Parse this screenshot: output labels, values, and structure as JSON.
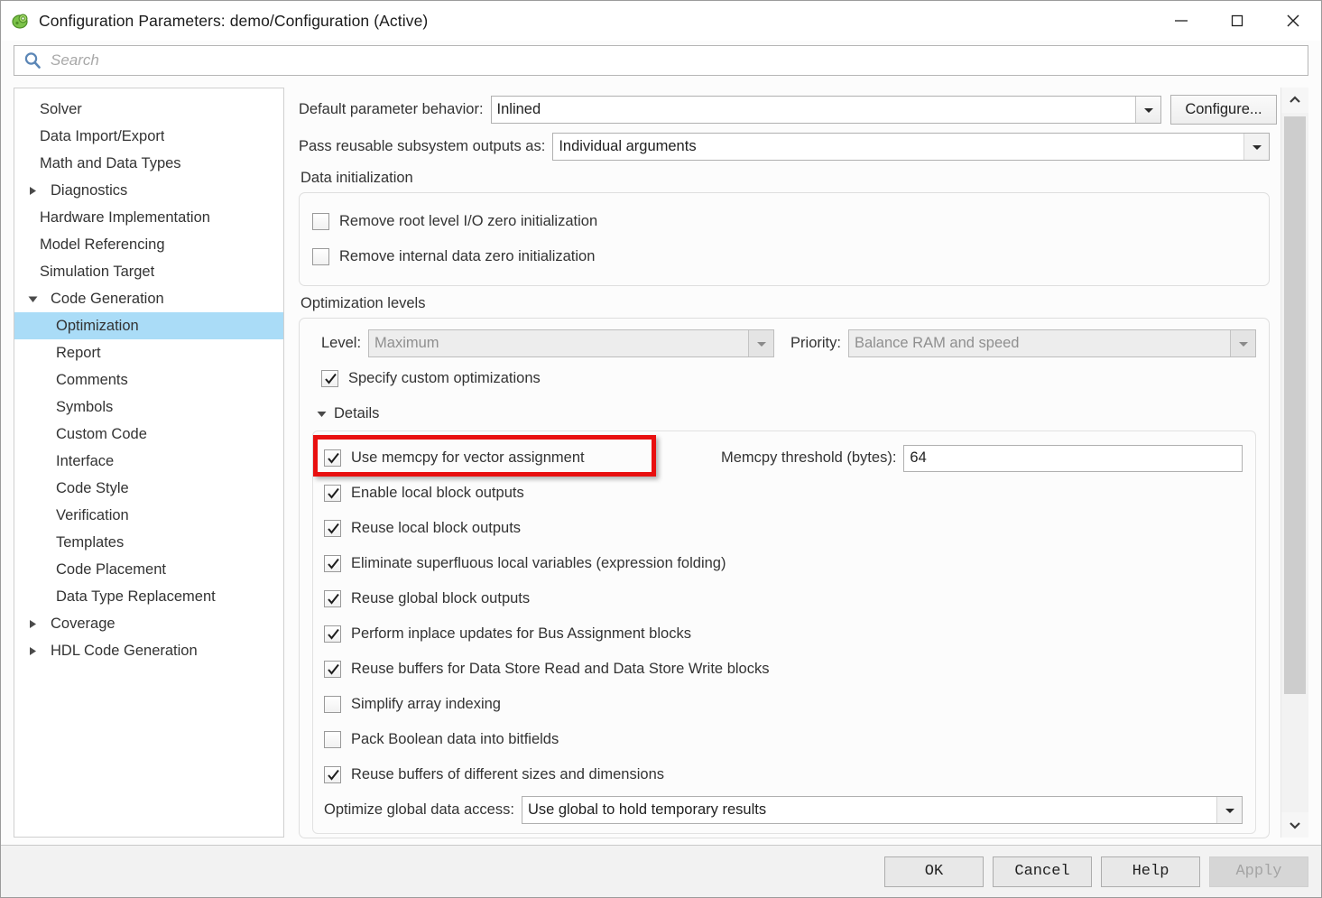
{
  "window": {
    "title": "Configuration Parameters: demo/Configuration (Active)",
    "app_icon": "simulink-logo-icon",
    "minimize_label": "—",
    "maximize_label": "□",
    "close_label": "✕"
  },
  "search": {
    "placeholder": "Search",
    "value": "",
    "icon": "search-icon"
  },
  "sidebar": {
    "items": [
      {
        "label": "Solver",
        "level": 0,
        "twisty": "none",
        "selected": false
      },
      {
        "label": "Data Import/Export",
        "level": 0,
        "twisty": "none",
        "selected": false
      },
      {
        "label": "Math and Data Types",
        "level": 0,
        "twisty": "none",
        "selected": false
      },
      {
        "label": "Diagnostics",
        "level": 0,
        "twisty": "collapsed",
        "selected": false
      },
      {
        "label": "Hardware Implementation",
        "level": 0,
        "twisty": "none",
        "selected": false
      },
      {
        "label": "Model Referencing",
        "level": 0,
        "twisty": "none",
        "selected": false
      },
      {
        "label": "Simulation Target",
        "level": 0,
        "twisty": "none",
        "selected": false
      },
      {
        "label": "Code Generation",
        "level": 0,
        "twisty": "expanded",
        "selected": false
      },
      {
        "label": "Optimization",
        "level": 1,
        "twisty": "none",
        "selected": true
      },
      {
        "label": "Report",
        "level": 1,
        "twisty": "none",
        "selected": false
      },
      {
        "label": "Comments",
        "level": 1,
        "twisty": "none",
        "selected": false
      },
      {
        "label": "Symbols",
        "level": 1,
        "twisty": "none",
        "selected": false
      },
      {
        "label": "Custom Code",
        "level": 1,
        "twisty": "none",
        "selected": false
      },
      {
        "label": "Interface",
        "level": 1,
        "twisty": "none",
        "selected": false
      },
      {
        "label": "Code Style",
        "level": 1,
        "twisty": "none",
        "selected": false
      },
      {
        "label": "Verification",
        "level": 1,
        "twisty": "none",
        "selected": false
      },
      {
        "label": "Templates",
        "level": 1,
        "twisty": "none",
        "selected": false
      },
      {
        "label": "Code Placement",
        "level": 1,
        "twisty": "none",
        "selected": false
      },
      {
        "label": "Data Type Replacement",
        "level": 1,
        "twisty": "none",
        "selected": false
      },
      {
        "label": "Coverage",
        "level": 0,
        "twisty": "collapsed",
        "selected": false
      },
      {
        "label": "HDL Code Generation",
        "level": 0,
        "twisty": "collapsed",
        "selected": false
      }
    ]
  },
  "main": {
    "default_parameter_behavior": {
      "label": "Default parameter behavior:",
      "value": "Inlined",
      "configure_button": "Configure..."
    },
    "pass_reusable_subsystem_outputs": {
      "label": "Pass reusable subsystem outputs as:",
      "value": "Individual arguments"
    },
    "data_initialization": {
      "title": "Data initialization",
      "checkboxes": [
        {
          "label": "Remove root level I/O zero initialization",
          "checked": false
        },
        {
          "label": "Remove internal data zero initialization",
          "checked": false
        }
      ]
    },
    "optimization_levels": {
      "title": "Optimization levels",
      "level_label": "Level:",
      "level_value": "Maximum",
      "level_disabled": true,
      "priority_label": "Priority:",
      "priority_value": "Balance RAM and speed",
      "priority_disabled": true,
      "specify_custom": {
        "label": "Specify custom optimizations",
        "checked": true
      },
      "details_label": "Details",
      "details_expanded": true,
      "memcpy": {
        "checkbox_label": "Use memcpy for vector assignment",
        "checked": true,
        "highlighted": true,
        "threshold_label": "Memcpy threshold (bytes):",
        "threshold_value": "64"
      },
      "detail_checkboxes": [
        {
          "label": "Enable local block outputs",
          "checked": true
        },
        {
          "label": "Reuse local block outputs",
          "checked": true
        },
        {
          "label": "Eliminate superfluous local variables (expression folding)",
          "checked": true
        },
        {
          "label": "Reuse global block outputs",
          "checked": true
        },
        {
          "label": "Perform inplace updates for Bus Assignment blocks",
          "checked": true
        },
        {
          "label": "Reuse buffers for Data Store Read and Data Store Write blocks",
          "checked": true
        },
        {
          "label": "Simplify array indexing",
          "checked": false
        },
        {
          "label": "Pack Boolean data into bitfields",
          "checked": false
        },
        {
          "label": "Reuse buffers of different sizes and dimensions",
          "checked": true
        }
      ],
      "optimize_global_data_access": {
        "label": "Optimize global data access:",
        "value": "Use global to hold temporary results"
      }
    }
  },
  "scrollbar": {
    "up_icon": "chevron-up-icon",
    "down_icon": "chevron-down-icon"
  },
  "footer": {
    "ok": "OK",
    "cancel": "Cancel",
    "help": "Help",
    "apply": "Apply",
    "apply_disabled": true
  },
  "colors": {
    "selection": "#aadcf7",
    "annotation": "#e81010",
    "accent_icon": "#5b86b6"
  }
}
